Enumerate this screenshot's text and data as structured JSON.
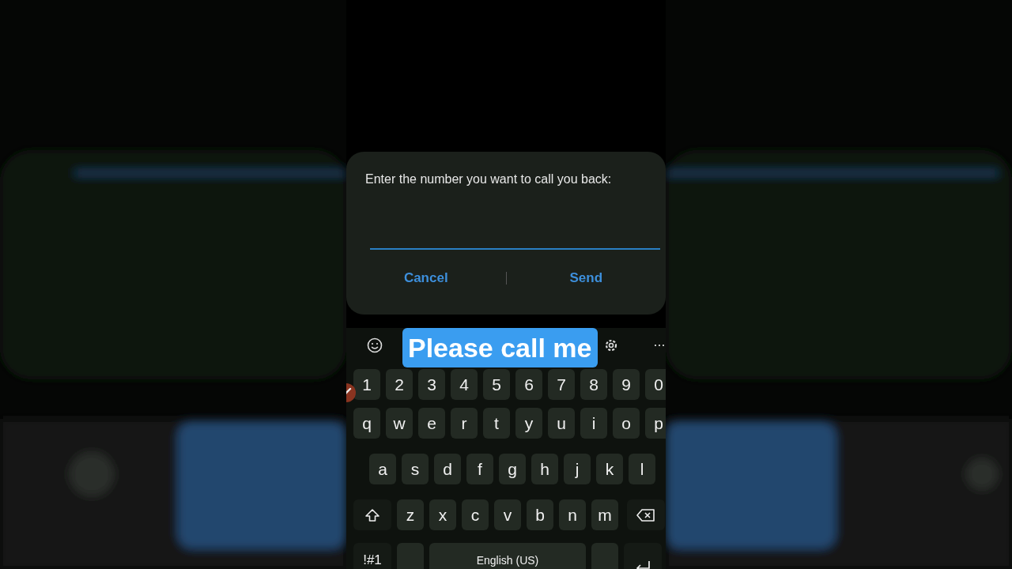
{
  "dialog": {
    "message": "Enter the number you want to call you back:",
    "buttons": [
      "Cancel",
      "Send"
    ]
  },
  "caption": "Please call me",
  "keyboard": {
    "more": "···",
    "rows": [
      {
        "keys": [
          {
            "kind": "char",
            "label": "1"
          },
          {
            "kind": "char",
            "label": "2"
          },
          {
            "kind": "char",
            "label": "3"
          },
          {
            "kind": "char",
            "label": "4"
          },
          {
            "kind": "char",
            "label": "5"
          },
          {
            "kind": "char",
            "label": "6"
          },
          {
            "kind": "char",
            "label": "7"
          },
          {
            "kind": "char",
            "label": "8"
          },
          {
            "kind": "char",
            "label": "9"
          },
          {
            "kind": "char",
            "label": "0"
          }
        ]
      },
      {
        "keys": [
          {
            "kind": "char",
            "label": "q"
          },
          {
            "kind": "char",
            "label": "w"
          },
          {
            "kind": "char",
            "label": "e"
          },
          {
            "kind": "char",
            "label": "r"
          },
          {
            "kind": "char",
            "label": "t"
          },
          {
            "kind": "char",
            "label": "y"
          },
          {
            "kind": "char",
            "label": "u"
          },
          {
            "kind": "char",
            "label": "i"
          },
          {
            "kind": "char",
            "label": "o"
          },
          {
            "kind": "char",
            "label": "p"
          }
        ]
      },
      {
        "keys": [
          {
            "kind": "char",
            "label": "a"
          },
          {
            "kind": "char",
            "label": "s"
          },
          {
            "kind": "char",
            "label": "d"
          },
          {
            "kind": "char",
            "label": "f"
          },
          {
            "kind": "char",
            "label": "g"
          },
          {
            "kind": "char",
            "label": "h"
          },
          {
            "kind": "char",
            "label": "j"
          },
          {
            "kind": "char",
            "label": "k"
          },
          {
            "kind": "char",
            "label": "l"
          }
        ]
      },
      {
        "keys": [
          {
            "kind": "shift"
          },
          {
            "kind": "char",
            "label": "z"
          },
          {
            "kind": "char",
            "label": "x"
          },
          {
            "kind": "char",
            "label": "c"
          },
          {
            "kind": "char",
            "label": "v"
          },
          {
            "kind": "char",
            "label": "b"
          },
          {
            "kind": "char",
            "label": "n"
          },
          {
            "kind": "char",
            "label": "m"
          },
          {
            "kind": "backspace"
          }
        ]
      },
      {
        "keys": [
          {
            "kind": "symbols",
            "label": "!#1"
          },
          {
            "kind": "blank"
          },
          {
            "kind": "space",
            "label": "English (US)"
          },
          {
            "kind": "blank"
          },
          {
            "kind": "enter"
          }
        ]
      }
    ]
  }
}
